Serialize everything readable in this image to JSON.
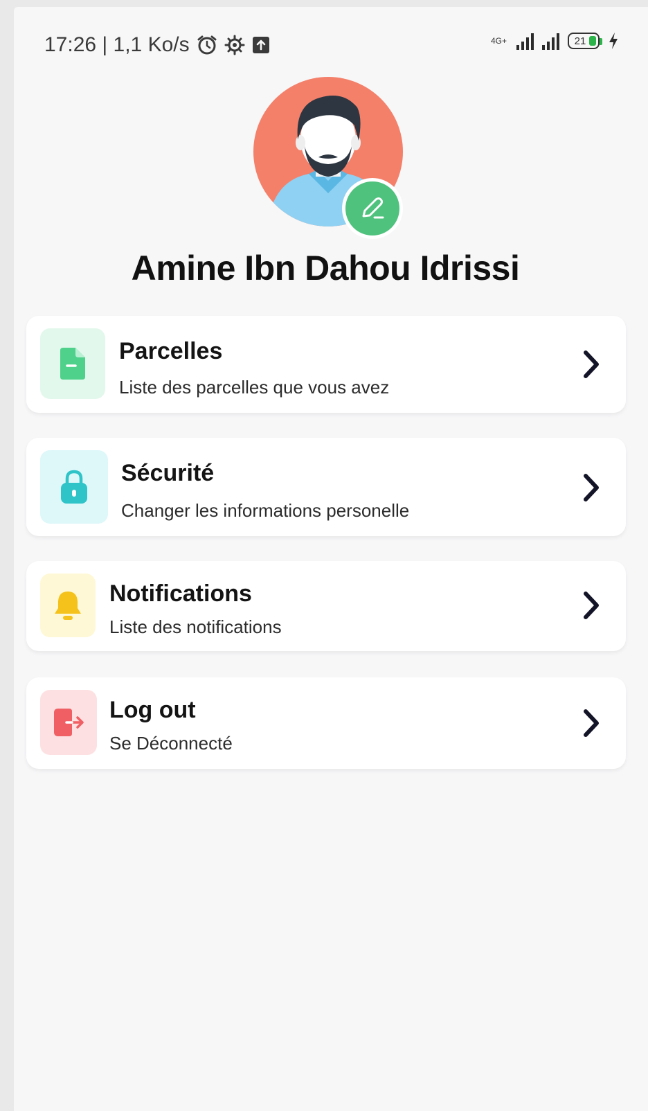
{
  "status_bar": {
    "time_speed": "17:26 | 1,1 Ko/s",
    "network": "4G+",
    "battery": "21",
    "icons": [
      "alarm-icon",
      "settings-gear-icon",
      "upload-icon",
      "signal-icon",
      "battery-icon",
      "charging-icon"
    ]
  },
  "profile": {
    "name": "Amine Ibn Dahou Idrissi",
    "avatar_bg": "#f4806a",
    "edit_badge_color": "#4fc27d"
  },
  "menu": [
    {
      "title": "Parcelles",
      "subtitle": "Liste des parcelles que vous avez",
      "icon": "document-icon",
      "icon_color": "#4fd18b",
      "icon_bg": "#e3f8ec"
    },
    {
      "title": "Sécurité",
      "subtitle": "Changer les informations personelle",
      "icon": "lock-icon",
      "icon_color": "#2ec4c8",
      "icon_bg": "#def7f9"
    },
    {
      "title": "Notifications",
      "subtitle": "Liste des notifications",
      "icon": "bell-icon",
      "icon_color": "#f4c21b",
      "icon_bg": "#fff8d6"
    },
    {
      "title": "Log out",
      "subtitle": "Se Déconnecté",
      "icon": "logout-icon",
      "icon_color": "#ef5f63",
      "icon_bg": "#fde1e2"
    }
  ]
}
